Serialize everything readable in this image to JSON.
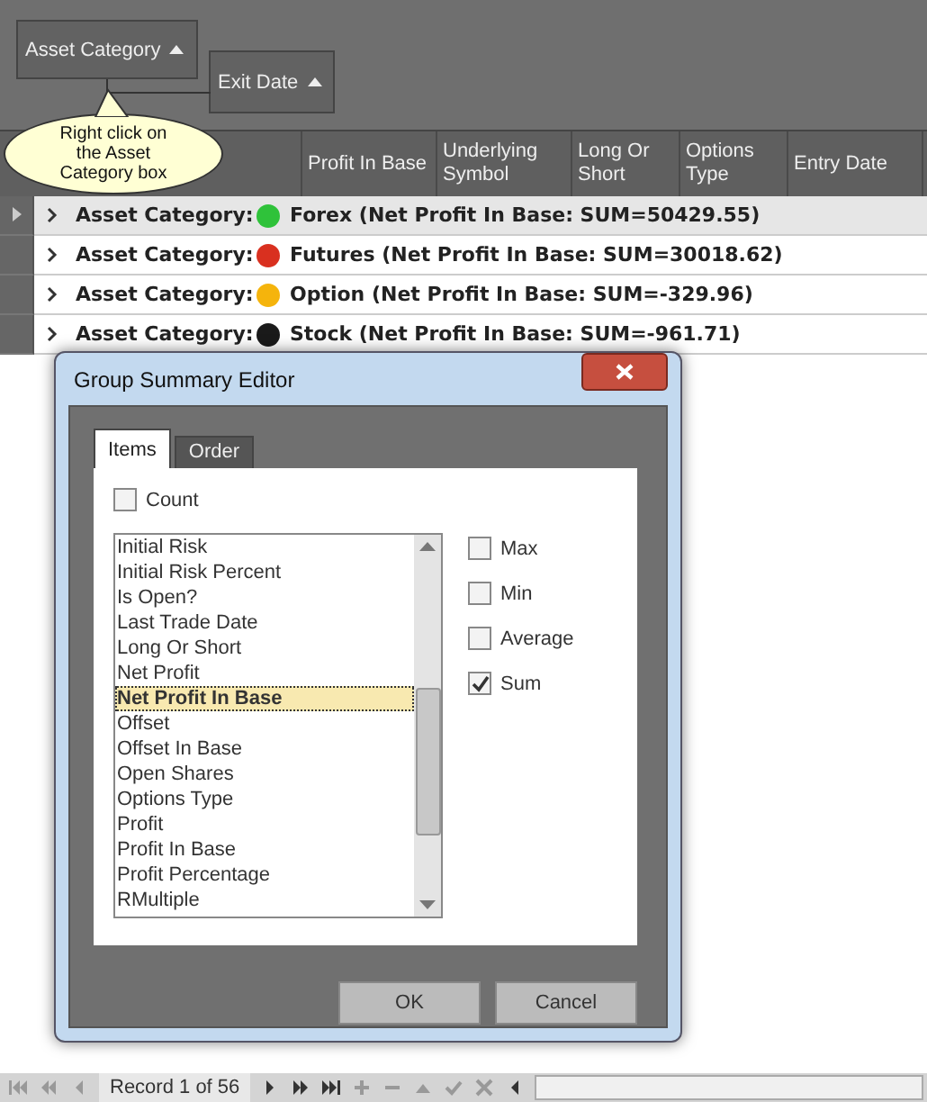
{
  "group_panel": {
    "boxes": [
      {
        "label": "Asset Category",
        "ascending": true
      },
      {
        "label": "Exit Date",
        "ascending": true
      }
    ],
    "callout": "Right click on the Asset Category box"
  },
  "grid": {
    "columns": [
      "Profit In Base",
      "Underlying Symbol",
      "Long Or Short",
      "Options Type",
      "Entry Date"
    ],
    "groups": [
      {
        "prefix": "Asset Category:",
        "value": "Forex (Net Profit In Base: SUM=50429.55)",
        "color": "#2fc23a",
        "selected": true
      },
      {
        "prefix": "Asset Category:",
        "value": "Futures (Net Profit In Base: SUM=30018.62)",
        "color": "#d9301f",
        "selected": false
      },
      {
        "prefix": "Asset Category:",
        "value": "Option (Net Profit In Base: SUM=-329.96)",
        "color": "#f5b40c",
        "selected": false
      },
      {
        "prefix": "Asset Category:",
        "value": "Stock (Net Profit In Base: SUM=-961.71)",
        "color": "#1a1a1a",
        "selected": false
      }
    ]
  },
  "dialog": {
    "title": "Group Summary Editor",
    "tabs": [
      {
        "label": "Items",
        "selected": true
      },
      {
        "label": "Order",
        "selected": false
      }
    ],
    "count": {
      "label": "Count",
      "checked": false
    },
    "fields": [
      {
        "label": "Initial Risk",
        "selected": false
      },
      {
        "label": "Initial Risk Percent",
        "selected": false
      },
      {
        "label": "Is Open?",
        "selected": false
      },
      {
        "label": "Last Trade Date",
        "selected": false
      },
      {
        "label": "Long Or Short",
        "selected": false
      },
      {
        "label": "Net Profit",
        "selected": false
      },
      {
        "label": "Net Profit In Base",
        "selected": true
      },
      {
        "label": "Offset",
        "selected": false
      },
      {
        "label": "Offset In Base",
        "selected": false
      },
      {
        "label": "Open Shares",
        "selected": false
      },
      {
        "label": "Options Type",
        "selected": false
      },
      {
        "label": "Profit",
        "selected": false
      },
      {
        "label": "Profit In Base",
        "selected": false
      },
      {
        "label": "Profit Percentage",
        "selected": false
      },
      {
        "label": "RMultiple",
        "selected": false
      }
    ],
    "functions": [
      {
        "label": "Max",
        "checked": false
      },
      {
        "label": "Min",
        "checked": false
      },
      {
        "label": "Average",
        "checked": false
      },
      {
        "label": "Sum",
        "checked": true
      }
    ],
    "buttons": [
      "OK",
      "Cancel"
    ]
  },
  "navigator": {
    "record": "Record 1 of 56"
  }
}
